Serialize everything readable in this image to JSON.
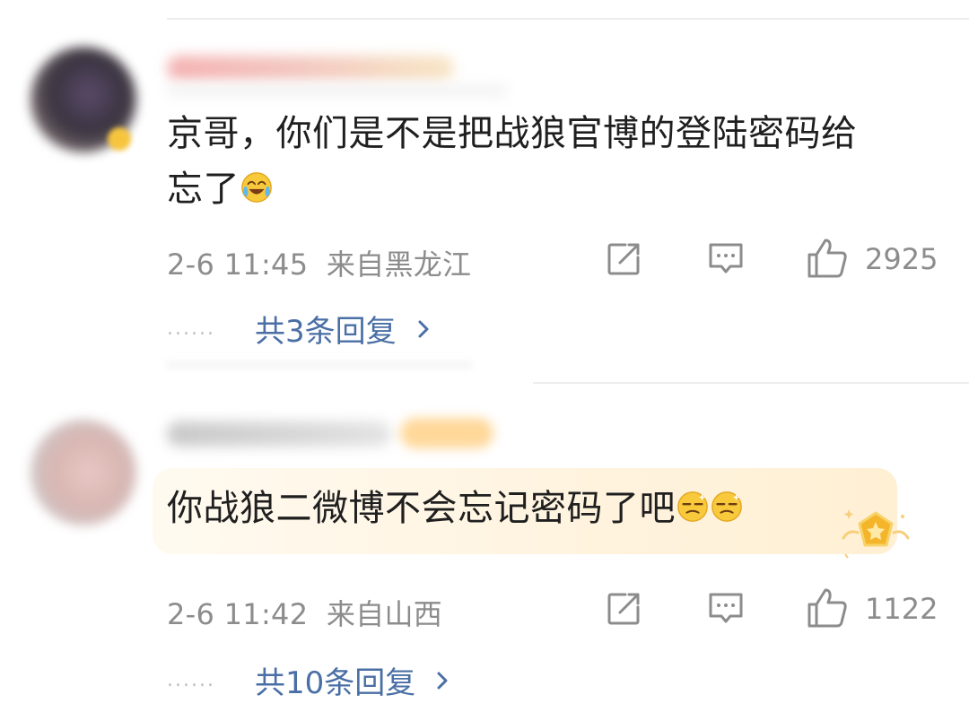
{
  "comments": [
    {
      "text_line1": "京哥，你们是不是把战狼官博的登陆密码给",
      "text_line2": "忘了",
      "emoji": "laugh-cry-emoji",
      "timestamp": "2-6 11:45",
      "location": "来自黑龙江",
      "likes": "2925",
      "replies_label": "共3条回复",
      "replies_dots": "......"
    },
    {
      "text": "你战狼二微博不会忘记密码了吧",
      "emoji": "dizzy-face-emoji",
      "timestamp": "2-6 11:42",
      "location": "来自山西",
      "likes": "1122",
      "replies_label": "共10条回复",
      "replies_dots": "......"
    }
  ],
  "icons": {
    "share": "share-icon",
    "comment": "comment-icon",
    "like": "thumbs-up-icon",
    "chevron": "chevron-right-icon",
    "medal": "star-medal-icon"
  },
  "colors": {
    "reply_link": "#4a6fa5",
    "meta": "#8c8c8c",
    "highlight": "#fff3de",
    "medal": "#f5b52a"
  }
}
